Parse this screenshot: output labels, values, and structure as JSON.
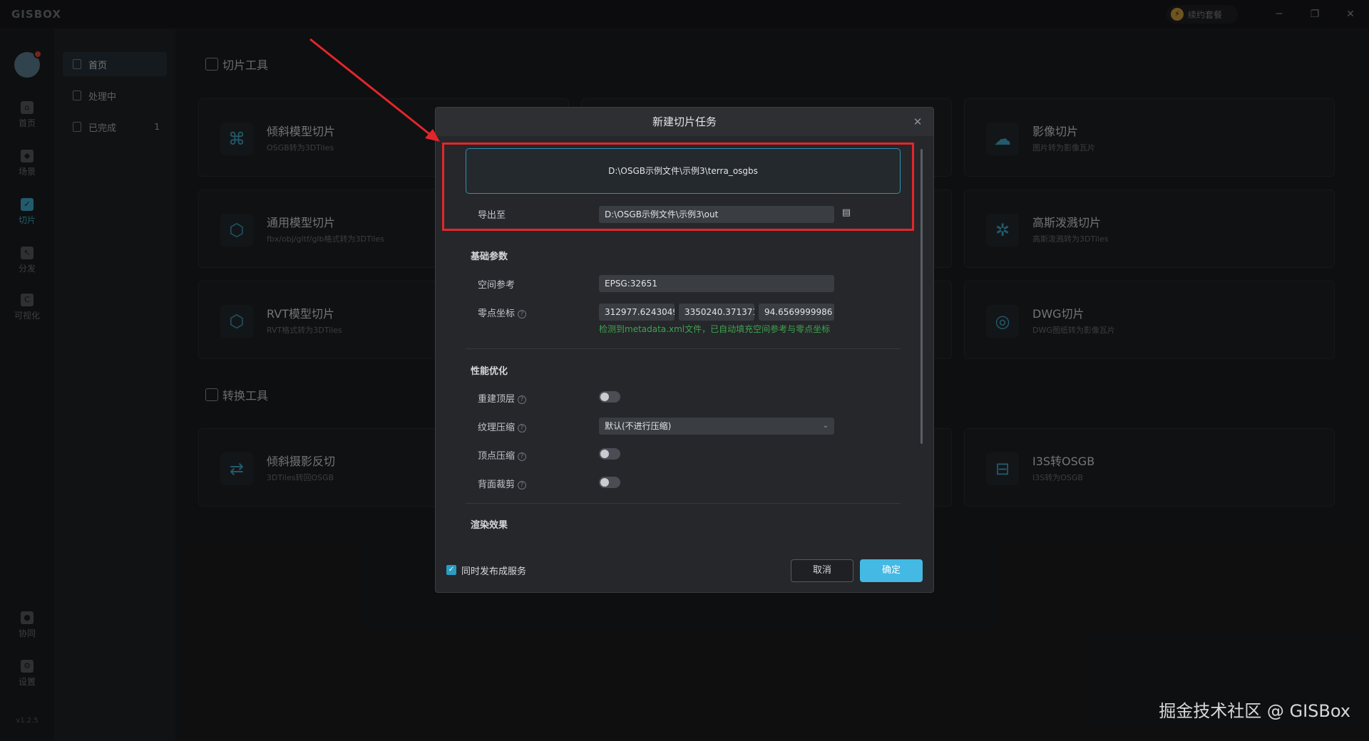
{
  "app": {
    "logo": "GISBOX",
    "renew_label": "续约套餐",
    "win_min": "─",
    "win_max": "❐",
    "win_close": "✕",
    "version": "v1.2.5"
  },
  "rail": {
    "items": [
      {
        "label": "首页",
        "icon": "home-icon"
      },
      {
        "label": "场景",
        "icon": "scene-icon"
      },
      {
        "label": "切片",
        "icon": "slice-icon"
      },
      {
        "label": "分发",
        "icon": "distribute-icon"
      },
      {
        "label": "可视化",
        "icon": "visual-icon"
      },
      {
        "label": "协同",
        "icon": "collab-icon"
      },
      {
        "label": "设置",
        "icon": "settings-icon"
      }
    ]
  },
  "side": {
    "items": [
      {
        "label": "首页"
      },
      {
        "label": "处理中"
      },
      {
        "label": "已完成",
        "count": "1"
      }
    ]
  },
  "main": {
    "slice_tools_title": "切片工具",
    "convert_tools_title": "转换工具",
    "cards": [
      {
        "title": "倾斜模型切片",
        "subtitle": "OSGB转为3DTiles"
      },
      {
        "title": "通用模型切片",
        "subtitle": "fbx/obj/gltf/glb格式转为3DTiles"
      },
      {
        "title": "RVT模型切片",
        "subtitle": "RVT格式转为3DTiles"
      },
      {
        "title": "影像切片",
        "subtitle": "图片转为影像瓦片"
      },
      {
        "title": "高斯泼溅切片",
        "subtitle": "高斯泼溅转为3DTiles"
      },
      {
        "title": "DWG切片",
        "subtitle": "DWG图纸转为影像瓦片"
      }
    ],
    "convert_cards": [
      {
        "title": "倾斜摄影反切",
        "subtitle": "3DTiles转回OSGB"
      },
      {
        "title": "I3S转OSGB",
        "subtitle": "I3S转为OSGB"
      }
    ]
  },
  "dialog": {
    "title": "新建切片任务",
    "source_path": "D:\\OSGB示例文件\\示例3\\terra_osgbs",
    "export_label": "导出至",
    "export_path": "D:\\OSGB示例文件\\示例3\\out",
    "basic_group": "基础参数",
    "srs_label": "空间参考",
    "srs_value": "EPSG:32651",
    "origin_label": "零点坐标",
    "origin_x": "312977.6243049",
    "origin_y": "3350240.371371",
    "origin_z": "94.6569999986",
    "auto_note": "检测到metadata.xml文件，已自动填充空间参考与零点坐标",
    "perf_group": "性能优化",
    "rebuild_top_label": "重建顶层",
    "texture_compress_label": "纹理压缩",
    "texture_compress_value": "默认(不进行压缩)",
    "vertex_compress_label": "顶点压缩",
    "backface_cull_label": "背面裁剪",
    "render_group": "渲染效果",
    "publish_label": "同时发布成服务",
    "cancel_label": "取消",
    "ok_label": "确定",
    "help_mark": "?"
  },
  "watermark": "掘金技术社区 @ GISBox",
  "colors": {
    "accent": "#43b9e3",
    "annotation": "#e3262b",
    "note_green": "#3fa34d"
  }
}
